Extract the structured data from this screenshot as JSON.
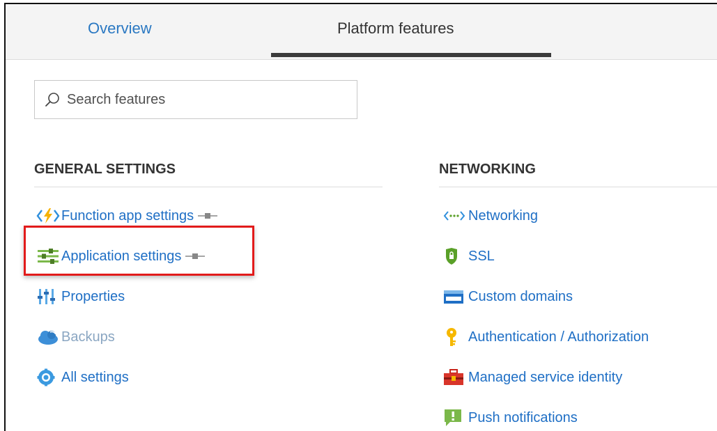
{
  "tabs": {
    "overview": "Overview",
    "platform_features": "Platform features",
    "active": "platform_features"
  },
  "search": {
    "placeholder": "Search features",
    "value": ""
  },
  "general_settings": {
    "title": "GENERAL SETTINGS",
    "items": [
      {
        "label": "Function app settings",
        "icon": "function-app-icon",
        "pinned": true
      },
      {
        "label": "Application settings",
        "icon": "application-settings-icon",
        "pinned": true,
        "highlighted": true
      },
      {
        "label": "Properties",
        "icon": "properties-icon"
      },
      {
        "label": "Backups",
        "icon": "backups-icon",
        "disabled": true
      },
      {
        "label": "All settings",
        "icon": "all-settings-icon"
      }
    ]
  },
  "networking": {
    "title": "NETWORKING",
    "items": [
      {
        "label": "Networking",
        "icon": "networking-icon"
      },
      {
        "label": "SSL",
        "icon": "ssl-shield-icon"
      },
      {
        "label": "Custom domains",
        "icon": "custom-domains-icon"
      },
      {
        "label": "Authentication / Authorization",
        "icon": "key-icon"
      },
      {
        "label": "Managed service identity",
        "icon": "toolbox-icon"
      },
      {
        "label": "Push notifications",
        "icon": "push-notifications-icon"
      }
    ]
  },
  "colors": {
    "link": "#1f6fc5",
    "tab_active_underline": "#3b3b3b",
    "highlight_border": "#e21b1b",
    "disabled_link": "#8aa6c2"
  }
}
